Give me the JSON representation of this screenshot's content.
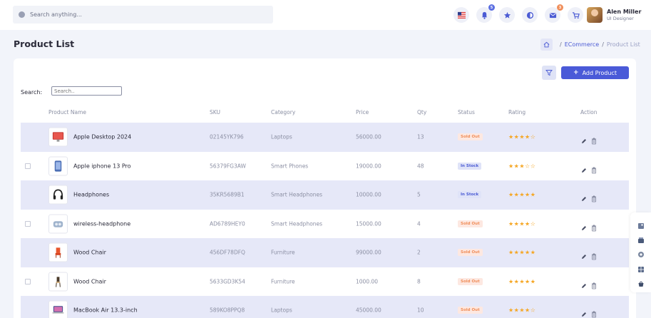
{
  "header": {
    "search_placeholder": "Search anything...",
    "icons": [
      {
        "name": "flag-icon"
      },
      {
        "name": "bell-icon",
        "badge": "5"
      },
      {
        "name": "star-icon"
      },
      {
        "name": "theme-icon"
      },
      {
        "name": "mail-icon",
        "badge": "3"
      },
      {
        "name": "cart-icon"
      }
    ],
    "user": {
      "name": "Alen Miller",
      "role": "UI Designer"
    }
  },
  "page": {
    "title": "Product List",
    "breadcrumb": {
      "link": "ECommerce",
      "current": "Product List",
      "separator": "/"
    }
  },
  "toolbar": {
    "add_label": "Add Product",
    "search_label": "Search:",
    "search_placeholder": "Search.."
  },
  "table": {
    "headers": [
      "Product Name",
      "SKU",
      "Category",
      "Price",
      "Qty",
      "Status",
      "Rating",
      "Action"
    ],
    "rows": [
      {
        "name": "Apple Desktop 2024",
        "sku": "02145YK796",
        "category": "Laptops",
        "price": "56000.00",
        "qty": "13",
        "status": "Sold Out",
        "rating": 4,
        "thumb": "desktop"
      },
      {
        "name": "Apple iphone 13 Pro",
        "sku": "56379FG3AW",
        "category": "Smart Phones",
        "price": "19000.00",
        "qty": "48",
        "status": "In Stock",
        "rating": 3,
        "thumb": "phone"
      },
      {
        "name": "Headphones",
        "sku": "35KR5689B1",
        "category": "Smart Headphones",
        "price": "10000.00",
        "qty": "5",
        "status": "In Stock",
        "rating": 5,
        "thumb": "headphones"
      },
      {
        "name": "wireless-headphone",
        "sku": "AD6789HEY0",
        "category": "Smart Headphones",
        "price": "15000.00",
        "qty": "4",
        "status": "Sold Out",
        "rating": 4,
        "thumb": "earbuds"
      },
      {
        "name": "Wood Chair",
        "sku": "456DF78DFQ",
        "category": "Furniture",
        "price": "99000.00",
        "qty": "2",
        "status": "Sold Out",
        "rating": 5,
        "thumb": "chair-orange"
      },
      {
        "name": "Wood Chair",
        "sku": "5633GD3K54",
        "category": "Furniture",
        "price": "1000.00",
        "qty": "8",
        "status": "Sold Out",
        "rating": 5,
        "thumb": "chair-wood"
      },
      {
        "name": "MacBook Air 13.3-inch",
        "sku": "589KO8PPQ8",
        "category": "Laptops",
        "price": "45000.00",
        "qty": "10",
        "status": "Sold Out",
        "rating": 4,
        "thumb": "macbook"
      }
    ]
  },
  "colors": {
    "accent": "#4a5ad8",
    "row_highlight": "#e6e8f8",
    "sold_out": "#f08e5a",
    "in_stock": "#4b5bd4",
    "star": "#f5a623"
  }
}
